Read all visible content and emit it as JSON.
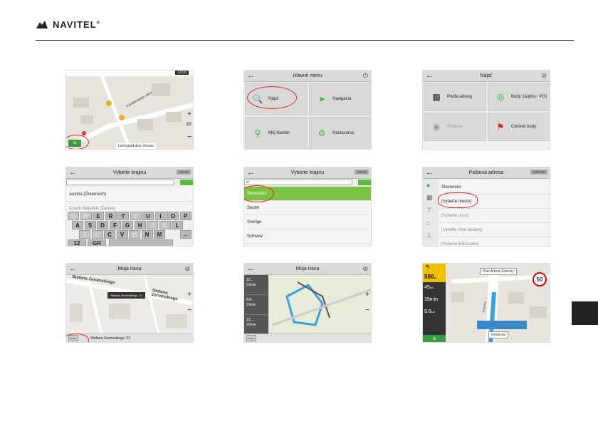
{
  "header": {
    "logo_text": "NAVITEL",
    "logo_reg": "®"
  },
  "s1": {
    "status": "12:00",
    "road": "Leningradskoe shosse",
    "street": "Panfilovskaja ulica",
    "zoom_plus": "+",
    "zoom_minus": "−",
    "mode": "2D"
  },
  "s2": {
    "title": "Hlavné menu",
    "tiles": [
      "Nájsť",
      "Navigácia",
      "Môj Navitel",
      "Nastavenia"
    ]
  },
  "s3": {
    "title": "Nájsť",
    "tiles": [
      "Podľa adresy",
      "Body záujmu / POI",
      "Priatelia",
      "Cieľové body"
    ]
  },
  "s4": {
    "title": "Vyberte krajinu",
    "btn": "Hľadať",
    "rows": [
      "Austria (Österreich)",
      "Czech Republic (Česko)"
    ],
    "keys_row1": [
      "Q",
      "W",
      "E",
      "R",
      "T",
      "Y",
      "U",
      "I",
      "O",
      "P"
    ],
    "keys_row2": [
      "A",
      "S",
      "D",
      "F",
      "G",
      "H",
      "J",
      "K",
      "L"
    ],
    "keys_row3": [
      "Z",
      "X",
      "C",
      "V",
      "B",
      "N",
      "M"
    ],
    "key_num": "12",
    "key_lang": "GR"
  },
  "s5": {
    "title": "Vyberte krajinu",
    "btn": "Hľadať",
    "input": "sl",
    "rows": [
      "Slovensko",
      "Suomi",
      "Sverige",
      "Schweiz"
    ]
  },
  "s6": {
    "title": "Poštová adresa",
    "btn": "Vyhľadať",
    "rows": [
      "Slovensko",
      "[Vyberte mesto]",
      "[Vyberte ulicu]",
      "[Uveďte číslo budovy]",
      "[Vyberte križovatku]"
    ]
  },
  "s7": {
    "title": "Moja trasa",
    "streets": [
      "Stefana Zeromskiego",
      "Stefana Zeromskiego"
    ],
    "popup": "Stefana Żeromskiego, 23",
    "btn": "Rozšír.",
    "address": "Stefana Żeromskiego, 23",
    "zoom_plus": "+",
    "zoom_minus": "−"
  },
  "s8": {
    "title": "Moja trasa",
    "routes": [
      [
        "12...",
        "21min"
      ],
      [
        "8.8...",
        "21min"
      ],
      [
        "13...",
        "20min"
      ]
    ],
    "btn": "Rozšír.",
    "zoom_plus": "+",
    "zoom_minus": "−"
  },
  "s9": {
    "top_street": "Plac Artura Zawiszy",
    "speed": "50",
    "dist": "500",
    "dist_unit": "m",
    "d2": "45",
    "d2_unit": "km",
    "time": "15min",
    "d3": "9.6",
    "d3_unit": "km",
    "side_street": "Grójecka",
    "bottom_street": "Grojecka"
  }
}
